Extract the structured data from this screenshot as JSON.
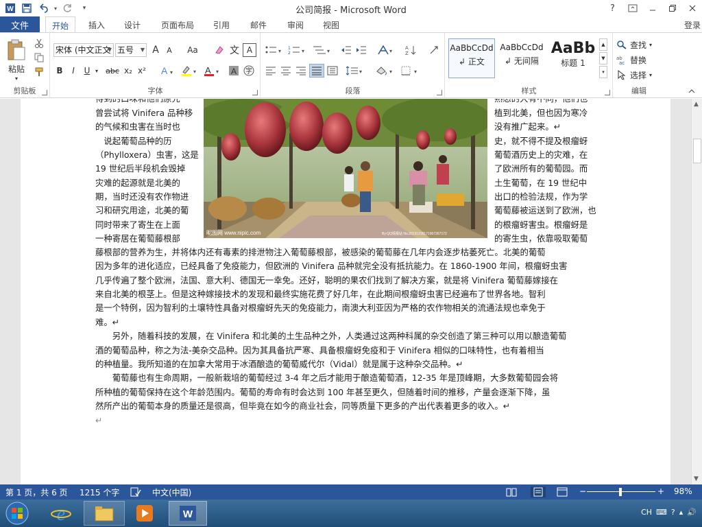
{
  "window": {
    "title": "公司简报 - Microsoft Word",
    "help": "?",
    "controls": [
      "ribbon-display",
      "minimize",
      "restore",
      "close"
    ]
  },
  "qat": {
    "icons": [
      "word-logo-icon",
      "save-icon",
      "undo-icon",
      "redo-icon",
      "customize-icon"
    ]
  },
  "tabs": {
    "file": "文件",
    "items": [
      "开始",
      "插入",
      "设计",
      "页面布局",
      "引用",
      "邮件",
      "审阅",
      "视图"
    ],
    "active": "开始",
    "login": "登录"
  },
  "ribbon": {
    "clipboard": {
      "label": "剪贴板",
      "paste": "粘贴"
    },
    "font": {
      "label": "字体",
      "font_name": "宋体 (中文正文",
      "font_size": "五号",
      "bold": "B",
      "italic": "I",
      "underline": "U",
      "strike": "abc",
      "sub": "x₂",
      "sup": "x²",
      "grow": "A",
      "shrink": "A",
      "case": "Aa",
      "wen": "文",
      "border_a": "A"
    },
    "paragraph": {
      "label": "段落"
    },
    "styles": {
      "label": "样式",
      "items": [
        {
          "sample": "AaBbCcDd",
          "name": "正文"
        },
        {
          "sample": "AaBbCcDd",
          "name": "无间隔"
        },
        {
          "sample": "AaBb",
          "name": "标题 1"
        }
      ]
    },
    "editing": {
      "label": "编辑",
      "find": "查找",
      "replace": "替换",
      "select": "选择"
    }
  },
  "document": {
    "left_lines": [
      "得到的口味和他们原先",
      "曾尝试将 Vinifera 品种移",
      "的气候和虫害在当时也",
      "　说起葡萄品种的历",
      "（Phylloxera）虫害，这是",
      "19 世纪后半段机会毁掉",
      "灾难的起源就是北美的",
      "期，当时还没有农作物进",
      "习和研究用途，北美的葡",
      "同时带来了寄生在上面",
      "一种寄居在葡萄藤根部"
    ],
    "right_lines": [
      "熟悉的大有不同，他们也",
      "植到北美，但也因为寒冷",
      "没有推广起来。↵",
      "史，就不得不提及根瘤蚜",
      "葡萄酒历史上的灾难，在",
      "了欧洲所有的葡萄园。而",
      "土生葡萄，在 19 世纪中",
      "出口的检验法规，作为学",
      "葡萄藤被运送到了欧洲，也",
      "的根瘤蚜害虫。根瘤蚜是",
      "的寄生虫，依靠吸取葡萄"
    ],
    "full_lines": [
      "藤根部的营养为生，并将体内还有毒素的排泄物注入葡萄藤根部，被感染的葡萄藤在几年内会逐步枯萎死亡。北美的葡萄",
      "因为多年的进化适应，已经具备了免疫能力，但欧洲的 Vinifera 品种就完全没有抵抗能力。在 1860-1900 年间，根瘤蚜虫害",
      "几乎传遍了整个欧洲，法国、意大利、德国无一幸免。还好，聪明的果农们找到了解决方案，就是将 Vinifera 葡萄藤嫁接在",
      "来自北美的根茎上。但是这种嫁接技术的发现和最终实施花费了好几年，在此期间根瘤蚜虫害已经遍布了世界各地。智利",
      "是一个特例，因为智利的土壤特性具备对根瘤蚜先天的免疫能力，南澳大利亚因为严格的农作物相关的流通法规也幸免于",
      "难。↵",
      "　　另外，随着科技的发展，在 Vinifera 和北美的土生品种之外，人类通过这两种科属的杂交创造了第三种可以用以酿造葡萄",
      "酒的葡萄品种，称之为法-美杂交品种。因为其具备抗严寒、具备根瘤蚜免疫和于 Vinifera 相似的口味特性，也有着相当",
      "的种植量。我所知道的在加拿大常用于冰酒酿造的葡萄威代尔（Vidal）就是属于这种杂交品种。↵",
      "　　葡萄藤也有生命周期，一般新栽培的葡萄经过 3-4 年之后才能用于酿造葡萄酒，12-35 年是顶峰期，大多数葡萄园会将",
      "所种植的葡萄保持在这个年龄范围内。葡萄的寿命有时会达到 100 年甚至更久，但随着时间的推移，产量会逐渐下降，虽",
      "然所产出的葡萄本身的质量还是很高，但毕竟在如今的商业社会，同等质量下更多的产出代表着更多的收入。↵",
      "↵"
    ],
    "photo": {
      "watermark_left": "昵图网 www.nipic.com",
      "watermark_right": "By:QQ情报站 No.20131216171907267172"
    }
  },
  "statusbar": {
    "page": "第 1 页，共 6 页",
    "words": "1215 个字",
    "language": "中文(中国)",
    "zoom": "98%",
    "zoom_level": 98
  },
  "taskbar": {
    "apps": [
      "start-orb-icon",
      "internet-explorer-icon",
      "file-explorer-icon",
      "media-player-icon",
      "word-taskbar-icon"
    ],
    "tray_lang": "CH"
  },
  "colors": {
    "accent": "#2b579a",
    "taskbar": "#1f4d78"
  }
}
